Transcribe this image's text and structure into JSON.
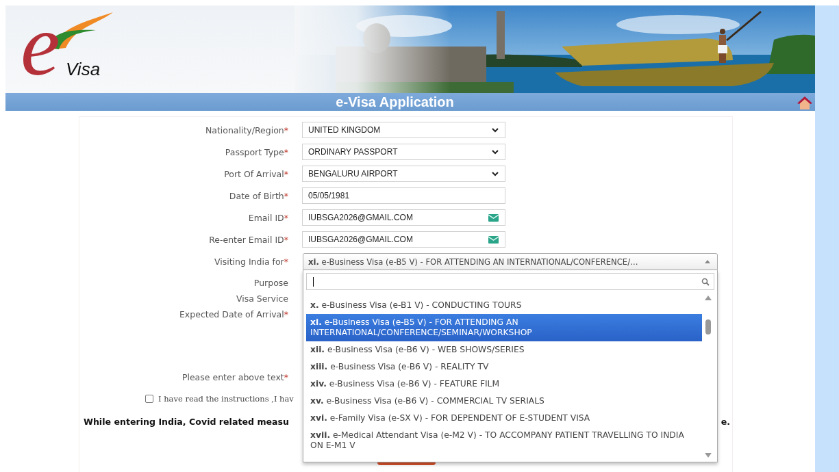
{
  "header": {
    "logo": {
      "mark": "e",
      "name": "Visa"
    }
  },
  "title_bar": {
    "title": "e-Visa Application"
  },
  "form": {
    "fields": [
      {
        "label": "Nationality/Region",
        "required_mark": "*",
        "kind": "select",
        "value": "UNITED KINGDOM"
      },
      {
        "label": "Passport Type",
        "required_mark": "*",
        "kind": "select",
        "value": "ORDINARY PASSPORT"
      },
      {
        "label": "Port Of Arrival",
        "required_mark": "*",
        "kind": "select",
        "value": "BENGALURU AIRPORT"
      },
      {
        "label": "Date of Birth",
        "required_mark": "*",
        "kind": "text",
        "value": "05/05/1981"
      },
      {
        "label": "Email ID",
        "required_mark": "*",
        "kind": "email",
        "value": "IUBSGA2026@GMAIL.COM"
      },
      {
        "label": "Re-enter Email ID",
        "required_mark": "*",
        "kind": "email",
        "value": "IUBSGA2026@GMAIL.COM"
      },
      {
        "label": "Visiting India for",
        "required_mark": "*",
        "kind": "combo",
        "expanded": true,
        "value": "**xi.** e-Business Visa (e-B5 V) - FOR ATTENDING AN INTERNATIONAL/CONFERENCE/…"
      },
      {
        "label": "Purpose",
        "kind": "hidden"
      },
      {
        "label": "Visa Service",
        "kind": "hidden"
      },
      {
        "label": "Expected Date of Arrival",
        "required_mark": "*",
        "kind": "hidden"
      },
      {
        "label": "Please enter above text",
        "required_mark": "*",
        "kind": "hidden",
        "gap_before": true
      }
    ],
    "dropdown": {
      "options": [
        {
          "text": "**x.** e-Business Visa (e-B1 V) - CONDUCTING TOURS",
          "selected": false
        },
        {
          "text": "**xi.** e-Business Visa (e-B5 V) - FOR ATTENDING AN INTERNATIONAL/CONFERENCE/SEMINAR/WORKSHOP",
          "selected": true
        },
        {
          "text": "**xii.** e-Business Visa (e-B6 V) - WEB SHOWS/SERIES",
          "selected": false
        },
        {
          "text": "**xiii.** e-Business Visa (e-B6 V) - REALITY TV",
          "selected": false
        },
        {
          "text": "**xiv.** e-Business Visa (e-B6 V) - FEATURE FILM",
          "selected": false
        },
        {
          "text": "**xv.** e-Business Visa (e-B6 V) - COMMERCIAL TV SERIALS",
          "selected": false
        },
        {
          "text": "**xvi.** e-Family Visa (e-SX V) - FOR DEPENDENT OF E-STUDENT VISA",
          "selected": false
        },
        {
          "text": "**xvii.** e-Medical Attendant Visa (e-M2 V) - TO ACCOMPANY PATIENT TRAVELLING TO INDIA ON E-M1 V",
          "selected": false
        }
      ]
    },
    "agreement": {
      "checked": false,
      "text": "I have read the instructions ,I hav"
    },
    "notice": {
      "text": "While entering India, Covid related measu",
      "tail": "e."
    }
  }
}
